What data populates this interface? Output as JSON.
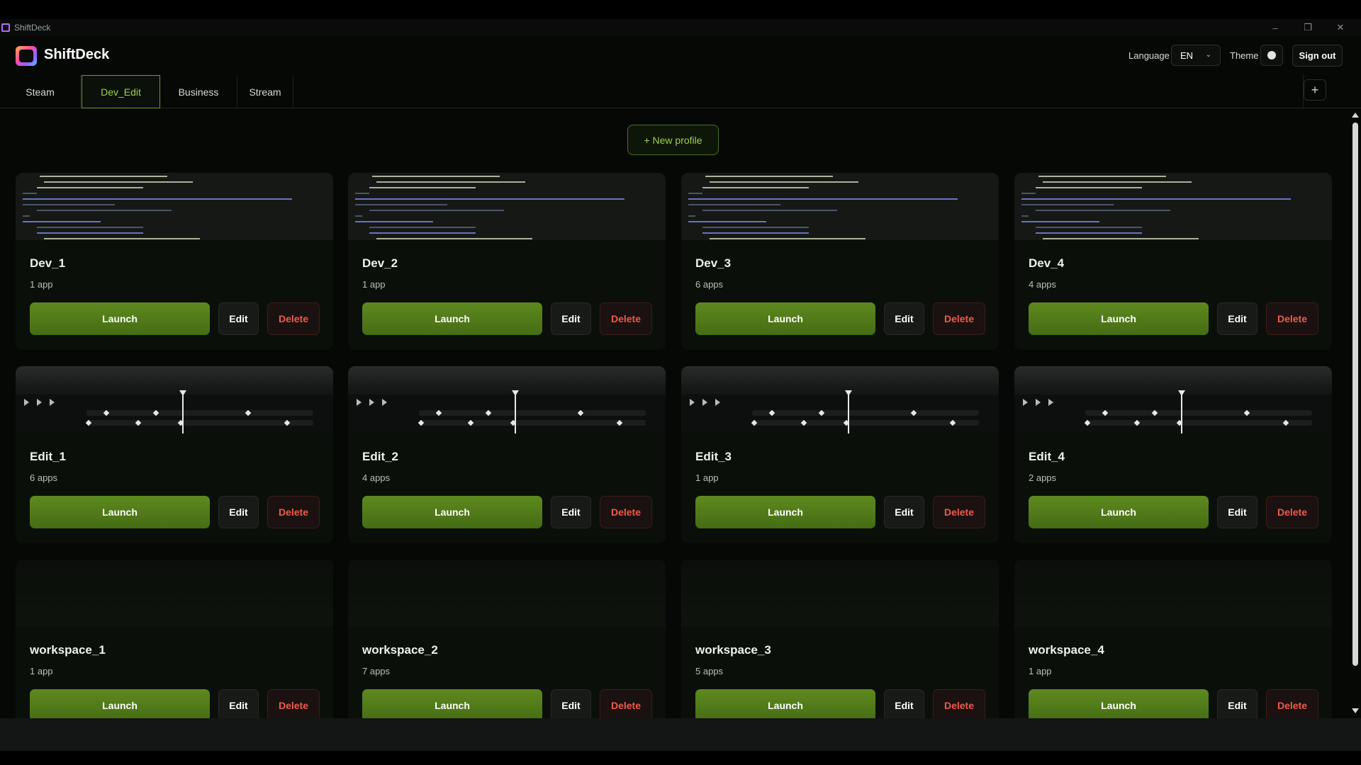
{
  "window": {
    "title": "ShiftDeck",
    "minimize": "–",
    "maximize": "❐",
    "close": "✕"
  },
  "header": {
    "brand": "ShiftDeck",
    "language_label": "Language",
    "language_value": "EN",
    "theme_label": "Theme",
    "sign_out": "Sign out"
  },
  "tabs": [
    {
      "label": "Steam",
      "active": false
    },
    {
      "label": "Dev_Edit",
      "active": true
    },
    {
      "label": "Business",
      "active": false
    },
    {
      "label": "Stream",
      "active": false
    }
  ],
  "tab_add": "+",
  "new_profile": "+ New profile",
  "buttons": {
    "launch": "Launch",
    "edit": "Edit",
    "delete": "Delete"
  },
  "profiles": [
    {
      "name": "Dev_1",
      "apps": "1 app",
      "thumb": "code"
    },
    {
      "name": "Dev_2",
      "apps": "1 app",
      "thumb": "code"
    },
    {
      "name": "Dev_3",
      "apps": "6 apps",
      "thumb": "code"
    },
    {
      "name": "Dev_4",
      "apps": "4 apps",
      "thumb": "code"
    },
    {
      "name": "Edit_1",
      "apps": "6 apps",
      "thumb": "timeline"
    },
    {
      "name": "Edit_2",
      "apps": "4 apps",
      "thumb": "timeline"
    },
    {
      "name": "Edit_3",
      "apps": "1 app",
      "thumb": "timeline"
    },
    {
      "name": "Edit_4",
      "apps": "2 apps",
      "thumb": "timeline"
    },
    {
      "name": "workspace_1",
      "apps": "1 app",
      "thumb": "empty"
    },
    {
      "name": "workspace_2",
      "apps": "7 apps",
      "thumb": "empty"
    },
    {
      "name": "workspace_3",
      "apps": "5 apps",
      "thumb": "empty"
    },
    {
      "name": "workspace_4",
      "apps": "1 app",
      "thumb": "empty"
    }
  ],
  "colors": {
    "accent": "#9fd04a",
    "launch": "#5e8a1f",
    "delete": "#ef5b4c",
    "background": "#060806"
  }
}
